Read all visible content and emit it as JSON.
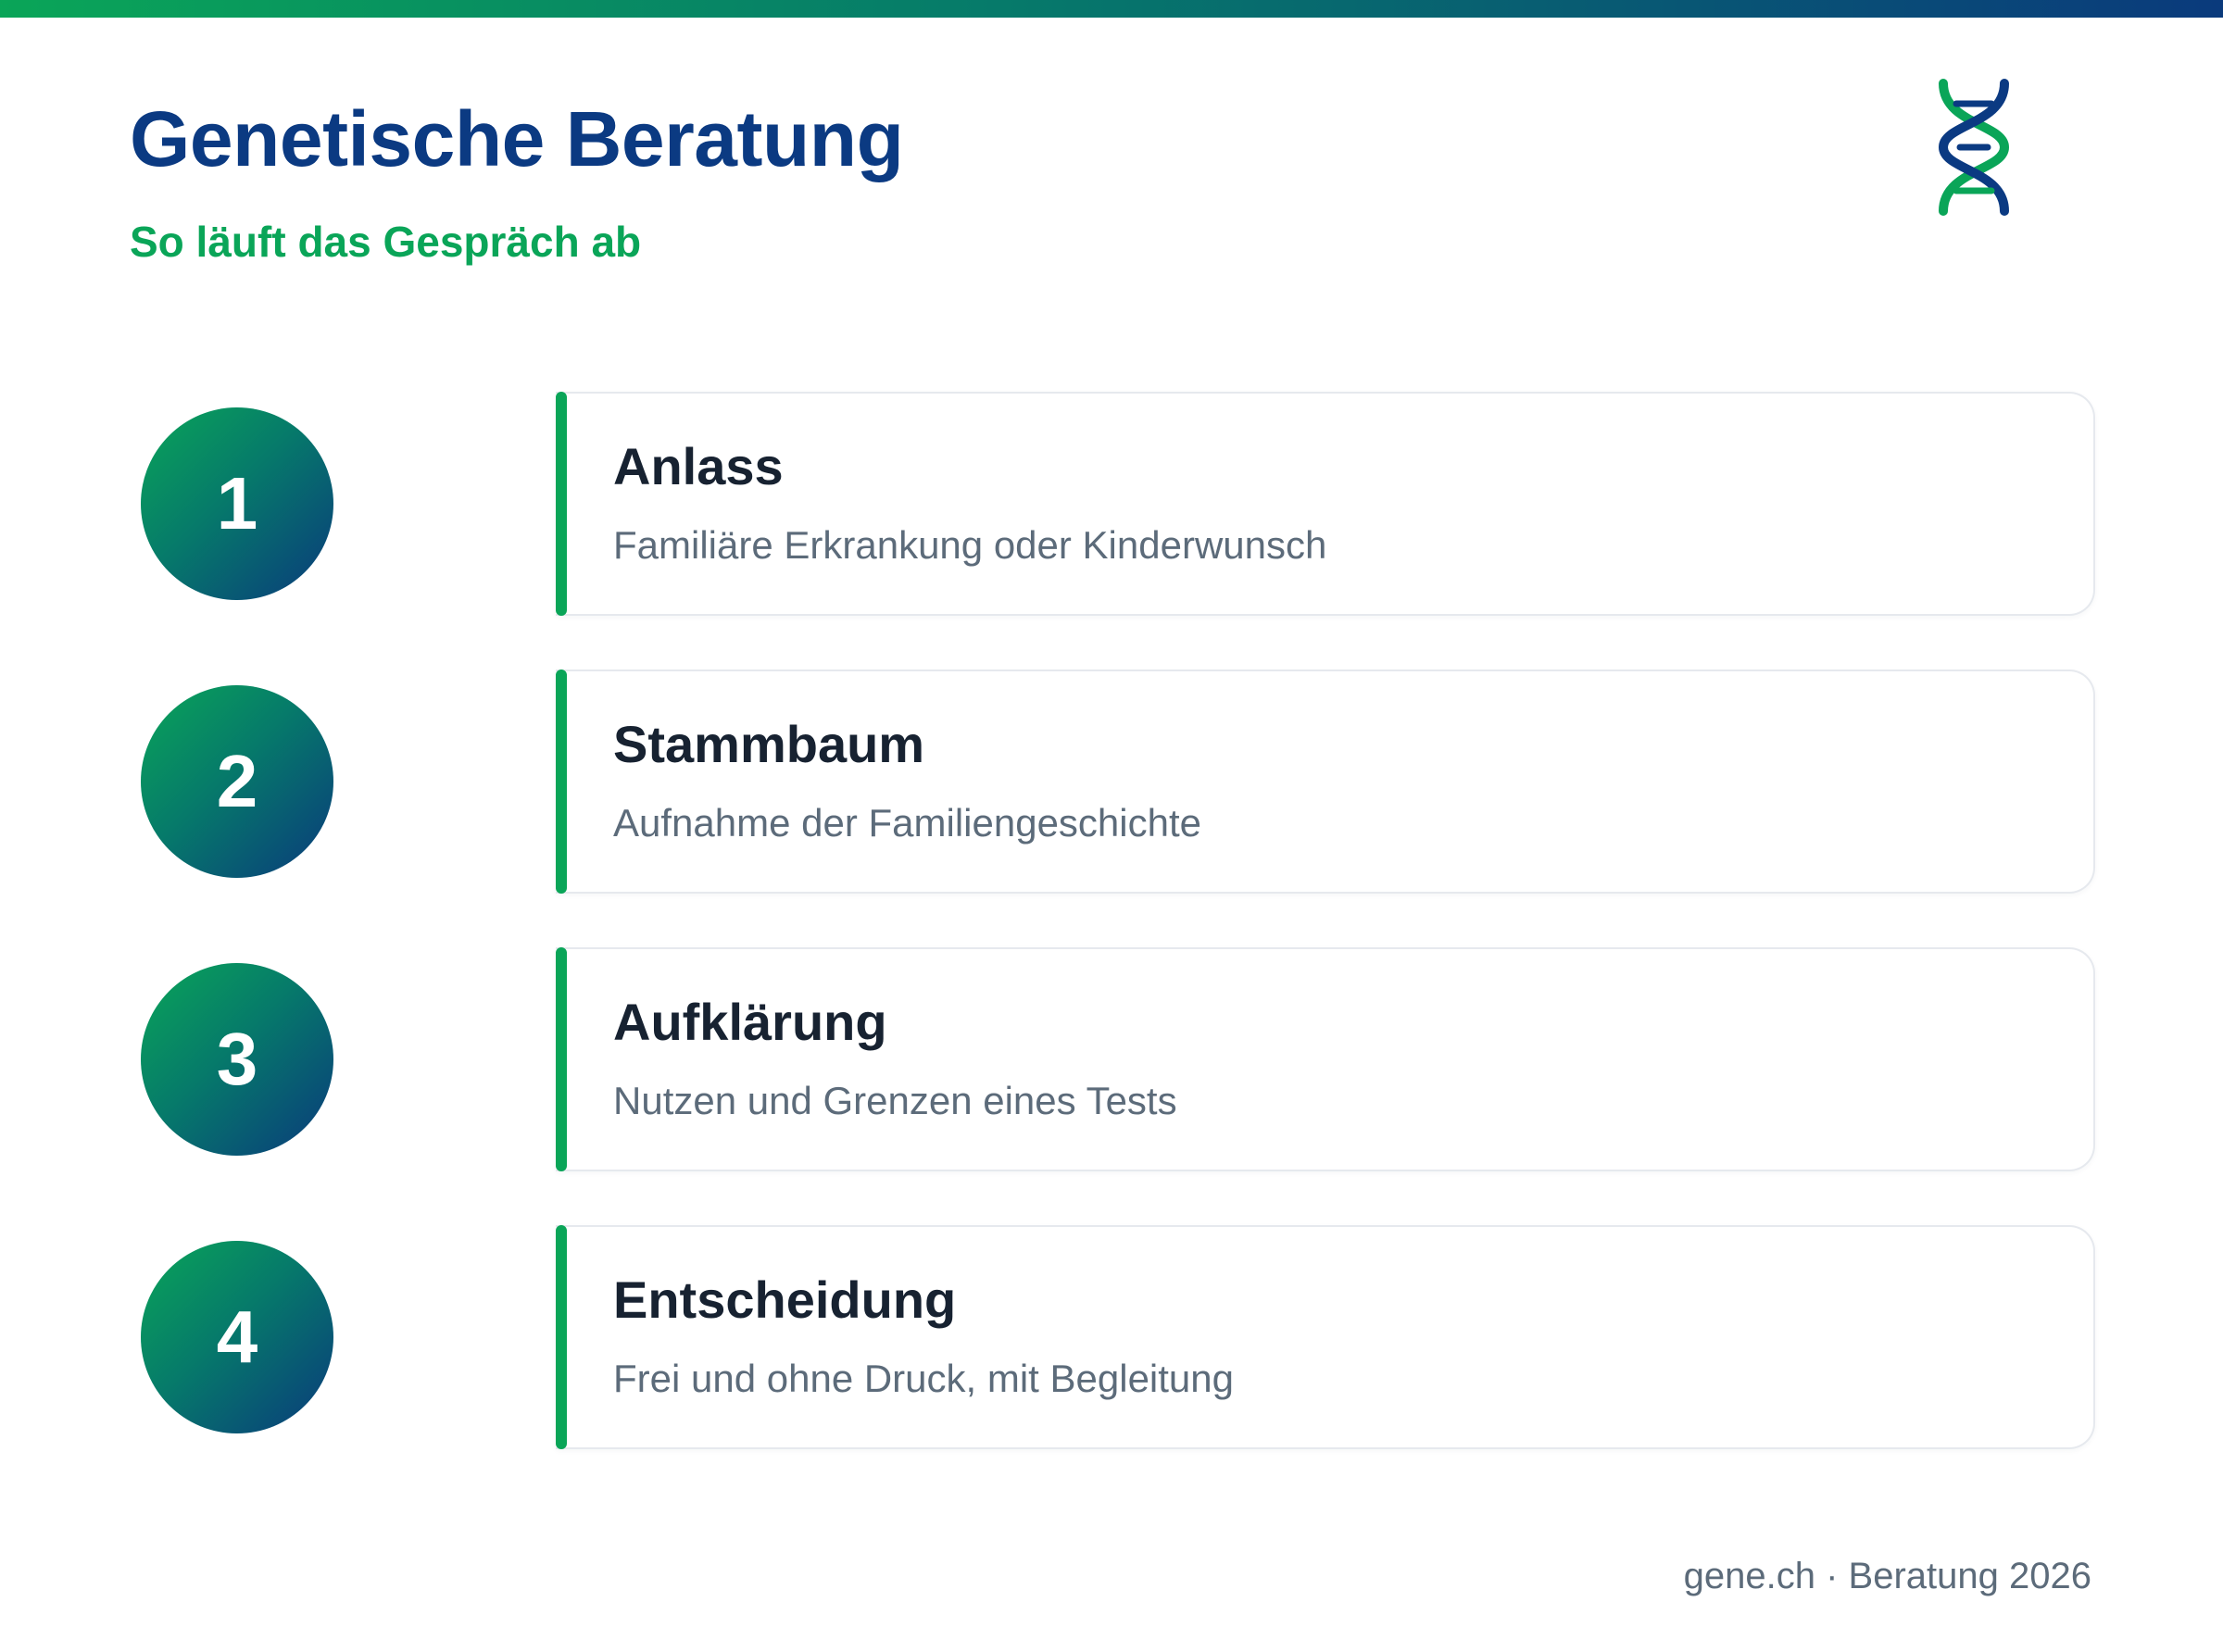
{
  "header": {
    "title": "Genetische Beratung",
    "subtitle": "So läuft das Gespräch ab",
    "logo_icon": "dna-icon"
  },
  "steps": [
    {
      "number": "1",
      "title": "Anlass",
      "description": "Familiäre Erkrankung oder Kinderwunsch"
    },
    {
      "number": "2",
      "title": "Stammbaum",
      "description": "Aufnahme der Familiengeschichte"
    },
    {
      "number": "3",
      "title": "Aufklärung",
      "description": "Nutzen und Grenzen eines Tests"
    },
    {
      "number": "4",
      "title": "Entscheidung",
      "description": "Frei und ohne Druck, mit Begleitung"
    }
  ],
  "footer": {
    "text": "gene.ch · Beratung 2026"
  },
  "colors": {
    "brand_blue": "#0b3a82",
    "brand_green": "#0aa558",
    "text_dark": "#172231",
    "text_muted": "#5c6b7a"
  }
}
